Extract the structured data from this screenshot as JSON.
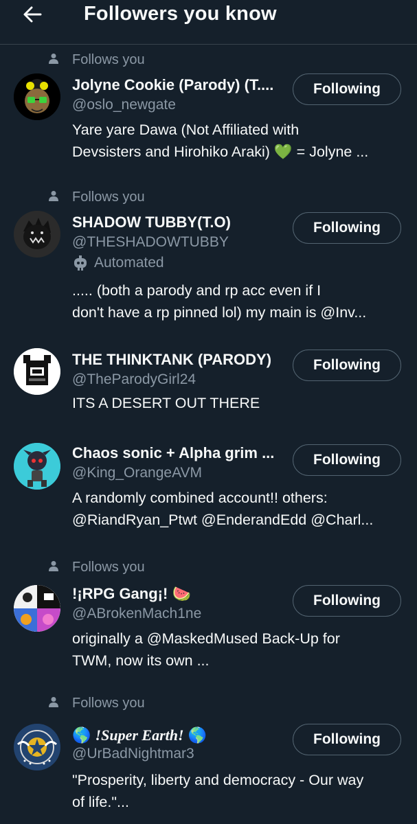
{
  "header": {
    "title": "Followers you know"
  },
  "users": [
    {
      "follows_you": "Follows you",
      "name": "Jolyne Cookie (Parody) (T....",
      "handle": "@oslo_newgate",
      "bio1": "Yare yare Dawa (Not Affiliated with",
      "bio2": "Devsisters and Hirohiko Araki) 💚 = Jolyne ...",
      "button": "Following"
    },
    {
      "follows_you": "Follows you",
      "name": "SHADOW TUBBY(T.O)",
      "handle": "@THESHADOWTUBBY",
      "automated": "Automated",
      "bio1": "..... (both a  parody and rp acc even if I",
      "bio2": "don't have a rp pinned lol) my main is @Inv...",
      "button": "Following"
    },
    {
      "name": "THE THINKTANK (PARODY)",
      "handle": "@TheParodyGirl24",
      "bio1": "ITS A DESERT OUT THERE",
      "button": "Following"
    },
    {
      "name": "Chaos sonic + Alpha grim ...",
      "handle": "@King_OrangeAVM",
      "bio1": "A randomly combined account!! others:",
      "bio2": "@RiandRyan_Ptwt @EnderandEdd @Charl...",
      "button": "Following"
    },
    {
      "follows_you": "Follows you",
      "name": "!¡RPG Gang¡!",
      "name_emoji": "🍉",
      "handle": "@ABrokenMach1ne",
      "bio1": "originally a @MaskedMused Back-Up for",
      "bio2": "TWM, now its own ...",
      "button": "Following"
    },
    {
      "follows_you": "Follows you",
      "name_emoji_left": "🌎",
      "name": "!Super Earth!",
      "name_emoji_right": "🌎",
      "handle": "@UrBadNightmar3",
      "bio1": "\"Prosperity, liberty and democracy - Our way",
      "bio2": "of life.\"...",
      "button": "Following"
    }
  ],
  "colors": {
    "background": "#15202b",
    "secondary_text": "#8b98a5",
    "border": "#38444d",
    "heart": "#3fb950"
  },
  "icons": [
    "back-arrow-icon",
    "person-icon",
    "robot-icon"
  ]
}
